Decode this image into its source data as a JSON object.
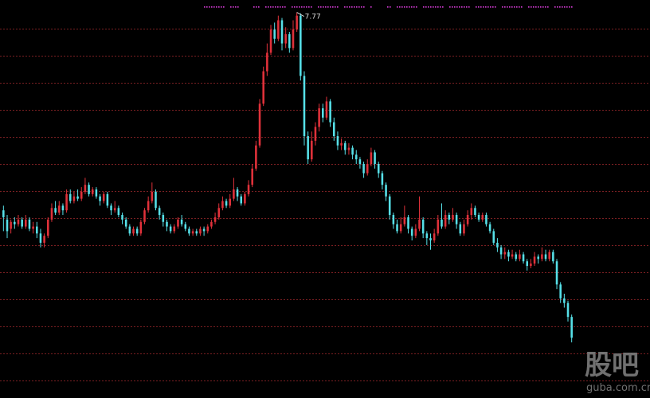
{
  "watermark": {
    "logo_text": "股吧",
    "site": "guba.com.cn"
  },
  "chart_data": {
    "type": "candlestick",
    "grid": true,
    "colors": {
      "up": "#e0313a",
      "down": "#56e0e8",
      "grid": "#7a1f22",
      "signal": "#e03ee0",
      "annotation": "#dcdcdc"
    },
    "ylim": [
      0,
      7.9
    ],
    "max_annotation": {
      "label": "7.77",
      "value": 7.77
    },
    "candles": [
      [
        3.5,
        3.35,
        3.6,
        3.05
      ],
      [
        3.3,
        3.05,
        3.4,
        2.9
      ],
      [
        3.1,
        3.25,
        3.3,
        3.0
      ],
      [
        3.25,
        3.2,
        3.35,
        3.1
      ],
      [
        3.2,
        3.3,
        3.4,
        3.15
      ],
      [
        3.3,
        3.15,
        3.35,
        3.1
      ],
      [
        3.15,
        3.3,
        3.4,
        3.1
      ],
      [
        3.3,
        3.1,
        3.35,
        3.05
      ],
      [
        3.1,
        3.15,
        3.25,
        3.0
      ],
      [
        3.15,
        3.0,
        3.25,
        2.9
      ],
      [
        3.0,
        2.8,
        3.1,
        2.7
      ],
      [
        2.8,
        2.95,
        3.0,
        2.7
      ],
      [
        2.95,
        3.3,
        3.35,
        2.9
      ],
      [
        3.3,
        3.55,
        3.65,
        3.25
      ],
      [
        3.55,
        3.45,
        3.7,
        3.4
      ],
      [
        3.45,
        3.6,
        3.7,
        3.4
      ],
      [
        3.6,
        3.5,
        3.65,
        3.4
      ],
      [
        3.5,
        3.85,
        3.95,
        3.45
      ],
      [
        3.85,
        3.7,
        3.95,
        3.65
      ],
      [
        3.7,
        3.8,
        3.9,
        3.65
      ],
      [
        3.8,
        3.75,
        3.95,
        3.7
      ],
      [
        3.75,
        3.9,
        4.0,
        3.7
      ],
      [
        3.9,
        4.05,
        4.2,
        3.85
      ],
      [
        4.05,
        3.85,
        4.1,
        3.8
      ],
      [
        3.85,
        3.95,
        4.0,
        3.8
      ],
      [
        3.95,
        3.8,
        4.0,
        3.75
      ],
      [
        3.8,
        3.7,
        3.85,
        3.6
      ],
      [
        3.7,
        3.85,
        3.9,
        3.65
      ],
      [
        3.85,
        3.6,
        3.9,
        3.55
      ],
      [
        3.6,
        3.5,
        3.65,
        3.4
      ],
      [
        3.5,
        3.55,
        3.7,
        3.45
      ],
      [
        3.55,
        3.4,
        3.6,
        3.35
      ],
      [
        3.4,
        3.3,
        3.45,
        3.2
      ],
      [
        3.3,
        3.15,
        3.35,
        3.1
      ],
      [
        3.15,
        3.0,
        3.2,
        2.95
      ],
      [
        3.0,
        3.1,
        3.15,
        2.95
      ],
      [
        3.1,
        3.0,
        3.15,
        2.95
      ],
      [
        3.0,
        3.25,
        3.3,
        2.95
      ],
      [
        3.25,
        3.5,
        3.55,
        3.2
      ],
      [
        3.5,
        3.7,
        3.8,
        3.45
      ],
      [
        3.7,
        3.9,
        4.1,
        3.65
      ],
      [
        3.9,
        3.55,
        3.95,
        3.5
      ],
      [
        3.55,
        3.4,
        3.6,
        3.3
      ],
      [
        3.4,
        3.25,
        3.45,
        3.15
      ],
      [
        3.25,
        3.15,
        3.3,
        3.05
      ],
      [
        3.15,
        3.05,
        3.2,
        3.0
      ],
      [
        3.05,
        3.15,
        3.2,
        3.0
      ],
      [
        3.15,
        3.3,
        3.35,
        3.1
      ],
      [
        3.3,
        3.2,
        3.4,
        3.15
      ],
      [
        3.2,
        3.1,
        3.25,
        3.05
      ],
      [
        3.1,
        3.0,
        3.15,
        2.95
      ],
      [
        3.0,
        3.05,
        3.1,
        2.95
      ],
      [
        3.05,
        3.0,
        3.1,
        2.95
      ],
      [
        3.0,
        3.1,
        3.15,
        2.95
      ],
      [
        3.1,
        3.05,
        3.15,
        2.95
      ],
      [
        3.05,
        3.15,
        3.2,
        3.0
      ],
      [
        3.15,
        3.25,
        3.3,
        3.1
      ],
      [
        3.25,
        3.35,
        3.45,
        3.2
      ],
      [
        3.35,
        3.55,
        3.65,
        3.3
      ],
      [
        3.55,
        3.7,
        3.8,
        3.5
      ],
      [
        3.7,
        3.6,
        3.75,
        3.55
      ],
      [
        3.6,
        3.75,
        3.85,
        3.55
      ],
      [
        3.75,
        3.95,
        4.2,
        3.7
      ],
      [
        3.95,
        3.8,
        4.0,
        3.7
      ],
      [
        3.8,
        3.65,
        3.85,
        3.6
      ],
      [
        3.65,
        3.85,
        3.9,
        3.6
      ],
      [
        3.85,
        4.05,
        4.15,
        3.8
      ],
      [
        4.05,
        4.4,
        4.5,
        4.0
      ],
      [
        4.4,
        4.9,
        5.0,
        4.35
      ],
      [
        4.9,
        5.8,
        5.9,
        4.85
      ],
      [
        5.8,
        6.5,
        6.6,
        5.75
      ],
      [
        6.5,
        6.9,
        7.1,
        6.4
      ],
      [
        6.9,
        7.4,
        7.5,
        6.85
      ],
      [
        7.4,
        7.2,
        7.55,
        7.1
      ],
      [
        7.2,
        7.6,
        7.7,
        7.15
      ],
      [
        7.6,
        7.1,
        7.65,
        6.95
      ],
      [
        7.1,
        7.3,
        7.45,
        7.0
      ],
      [
        7.3,
        7.0,
        7.35,
        6.9
      ],
      [
        7.0,
        7.4,
        7.6,
        6.95
      ],
      [
        7.4,
        7.7,
        7.77,
        7.35
      ],
      [
        7.7,
        6.4,
        7.75,
        6.3
      ],
      [
        6.4,
        5.1,
        6.5,
        4.9
      ],
      [
        5.1,
        4.6,
        5.2,
        4.5
      ],
      [
        4.6,
        5.0,
        5.2,
        4.55
      ],
      [
        5.0,
        5.3,
        5.4,
        4.9
      ],
      [
        5.3,
        5.7,
        5.8,
        5.2
      ],
      [
        5.7,
        5.5,
        5.8,
        5.4
      ],
      [
        5.5,
        5.85,
        5.95,
        5.45
      ],
      [
        5.85,
        5.4,
        5.9,
        5.3
      ],
      [
        5.4,
        5.1,
        5.5,
        5.0
      ],
      [
        5.1,
        4.9,
        5.2,
        4.8
      ],
      [
        4.9,
        4.95,
        5.05,
        4.8
      ],
      [
        4.95,
        4.8,
        5.0,
        4.7
      ],
      [
        4.8,
        4.85,
        4.95,
        4.7
      ],
      [
        4.85,
        4.7,
        4.9,
        4.6
      ],
      [
        4.7,
        4.6,
        4.8,
        4.5
      ],
      [
        4.6,
        4.5,
        4.65,
        4.4
      ],
      [
        4.5,
        4.3,
        4.55,
        4.2
      ],
      [
        4.3,
        4.5,
        4.6,
        4.25
      ],
      [
        4.5,
        4.75,
        4.85,
        4.45
      ],
      [
        4.75,
        4.5,
        4.8,
        4.4
      ],
      [
        4.5,
        4.3,
        4.55,
        4.2
      ],
      [
        4.3,
        4.05,
        4.35,
        3.95
      ],
      [
        4.05,
        3.8,
        4.1,
        3.7
      ],
      [
        3.8,
        3.4,
        3.85,
        3.3
      ],
      [
        3.4,
        3.2,
        3.45,
        3.1
      ],
      [
        3.2,
        3.05,
        3.3,
        3.0
      ],
      [
        3.05,
        3.2,
        3.35,
        3.0
      ],
      [
        3.2,
        3.35,
        3.6,
        3.15
      ],
      [
        3.35,
        3.1,
        3.4,
        3.0
      ],
      [
        3.1,
        2.95,
        3.15,
        2.85
      ],
      [
        2.95,
        3.1,
        3.2,
        2.9
      ],
      [
        3.1,
        3.3,
        3.8,
        3.05
      ],
      [
        3.3,
        3.0,
        3.35,
        2.9
      ],
      [
        3.0,
        2.9,
        3.05,
        2.75
      ],
      [
        2.9,
        2.85,
        3.0,
        2.65
      ],
      [
        2.85,
        3.0,
        3.1,
        2.8
      ],
      [
        3.0,
        3.3,
        3.4,
        2.95
      ],
      [
        3.3,
        3.15,
        3.65,
        3.1
      ],
      [
        3.15,
        3.4,
        3.5,
        3.1
      ],
      [
        3.4,
        3.3,
        3.45,
        3.2
      ],
      [
        3.3,
        3.4,
        3.55,
        3.25
      ],
      [
        3.4,
        3.2,
        3.45,
        3.1
      ],
      [
        3.2,
        3.0,
        3.25,
        2.95
      ],
      [
        3.0,
        3.2,
        3.3,
        2.95
      ],
      [
        3.2,
        3.4,
        3.5,
        3.15
      ],
      [
        3.4,
        3.55,
        3.65,
        3.3
      ],
      [
        3.55,
        3.4,
        3.6,
        3.35
      ],
      [
        3.4,
        3.3,
        3.45,
        3.25
      ],
      [
        3.3,
        3.4,
        3.45,
        3.25
      ],
      [
        3.4,
        3.2,
        3.45,
        3.15
      ],
      [
        3.2,
        3.05,
        3.25,
        3.0
      ],
      [
        3.05,
        2.8,
        3.1,
        2.75
      ],
      [
        2.8,
        2.7,
        2.9,
        2.6
      ],
      [
        2.7,
        2.55,
        2.75,
        2.45
      ],
      [
        2.55,
        2.6,
        2.7,
        2.45
      ],
      [
        2.6,
        2.5,
        2.65,
        2.4
      ],
      [
        2.5,
        2.55,
        2.65,
        2.45
      ],
      [
        2.55,
        2.45,
        2.6,
        2.4
      ],
      [
        2.45,
        2.55,
        2.65,
        2.4
      ],
      [
        2.55,
        2.4,
        2.6,
        2.35
      ],
      [
        2.4,
        2.3,
        2.45,
        2.2
      ],
      [
        2.3,
        2.35,
        2.45,
        2.25
      ],
      [
        2.35,
        2.5,
        2.6,
        2.3
      ],
      [
        2.5,
        2.45,
        2.55,
        2.35
      ],
      [
        2.45,
        2.55,
        2.7,
        2.4
      ],
      [
        2.55,
        2.45,
        2.65,
        2.4
      ],
      [
        2.45,
        2.6,
        2.65,
        2.4
      ],
      [
        2.6,
        2.4,
        2.65,
        2.35
      ],
      [
        2.4,
        1.9,
        2.45,
        1.8
      ],
      [
        1.9,
        1.6,
        1.95,
        1.5
      ],
      [
        1.6,
        1.5,
        1.7,
        1.4
      ],
      [
        1.5,
        1.2,
        1.55,
        1.1
      ],
      [
        1.2,
        0.75,
        1.25,
        0.65
      ]
    ]
  }
}
